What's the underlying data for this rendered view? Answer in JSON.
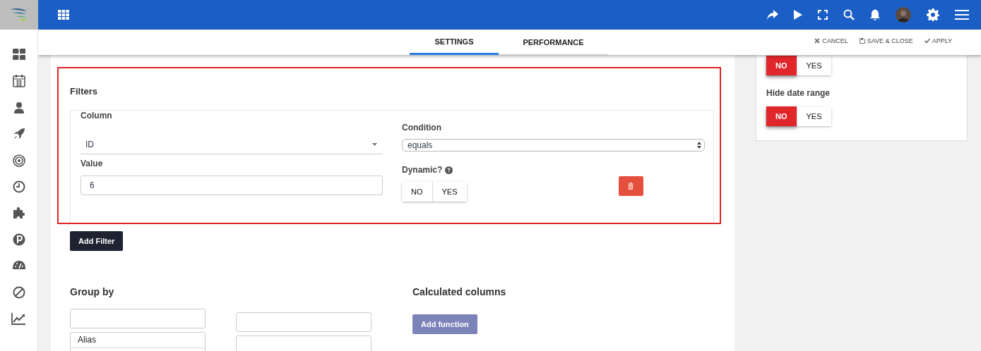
{
  "tabs": [
    {
      "label": "SETTINGS",
      "selected": true
    },
    {
      "label": "PERFORMANCE",
      "selected": false
    }
  ],
  "actions": [
    {
      "kind": "cancel",
      "label": "CANCEL"
    },
    {
      "kind": "save",
      "label": "SAVE & CLOSE"
    },
    {
      "kind": "apply",
      "label": "APPLY"
    }
  ],
  "filters": {
    "title": "Filters",
    "rows": [
      {
        "column_label": "Column",
        "column_value": "ID",
        "value_label": "Value",
        "value": "6",
        "condition_label": "Condition",
        "condition_value": "equals",
        "dynamic_label": "Dynamic?",
        "dynamic_options": [
          {
            "label": "NO",
            "selected": false
          },
          {
            "label": "YES",
            "selected": false
          }
        ]
      }
    ],
    "add_button": "Add Filter"
  },
  "group_by": {
    "title": "Group by",
    "list_items": [
      "Alias"
    ]
  },
  "calculated_columns": {
    "title": "Calculated columns",
    "add_button": "Add function"
  },
  "right_panel": {
    "toggles": [
      {
        "options": [
          {
            "label": "NO",
            "selected": true
          },
          {
            "label": "YES",
            "selected": false
          }
        ]
      },
      {
        "label": "Hide date range",
        "options": [
          {
            "label": "NO",
            "selected": true
          },
          {
            "label": "YES",
            "selected": false
          }
        ]
      }
    ]
  }
}
